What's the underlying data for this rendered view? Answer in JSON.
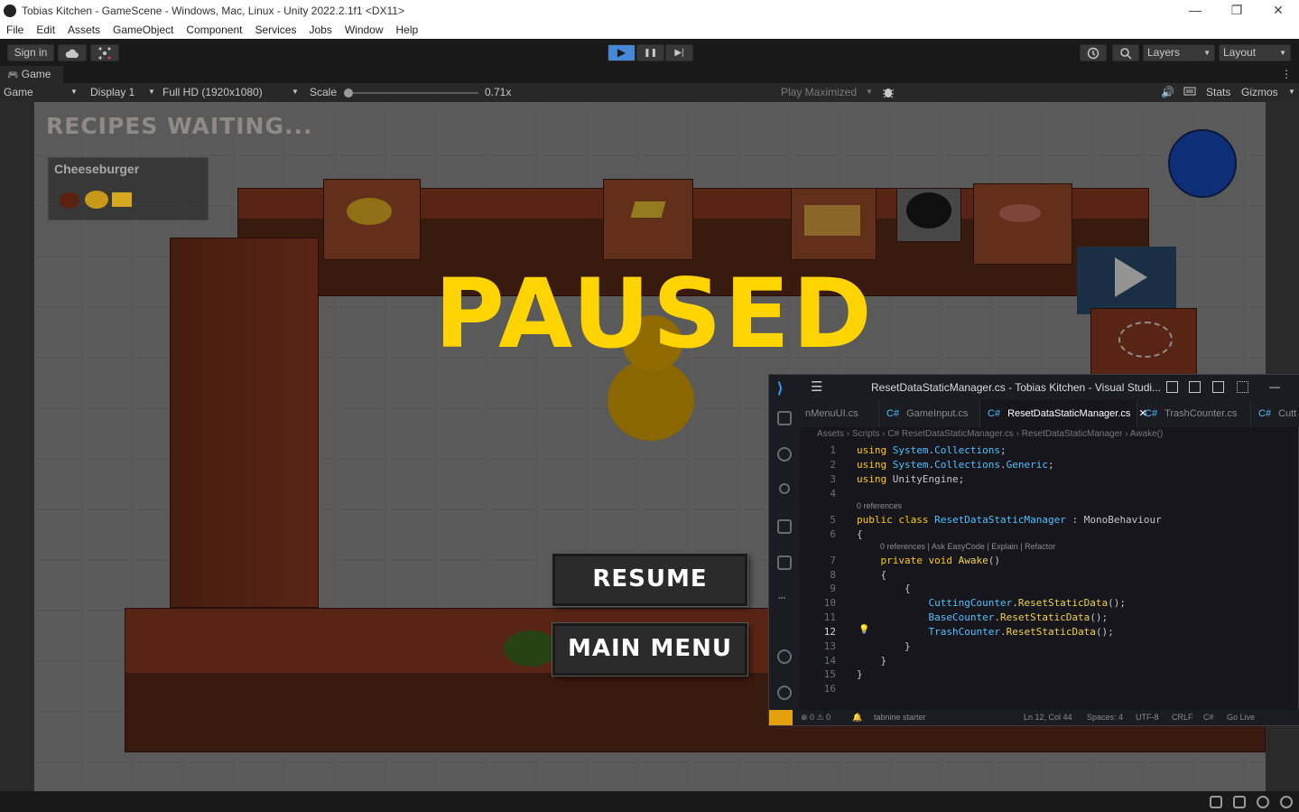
{
  "window": {
    "title": "Tobias Kitchen - GameScene - Windows, Mac, Linux - Unity 2022.2.1f1 <DX11>",
    "controls": [
      "—",
      "❐",
      "✕"
    ]
  },
  "menu": [
    "File",
    "Edit",
    "Assets",
    "GameObject",
    "Component",
    "Services",
    "Jobs",
    "Window",
    "Help"
  ],
  "toolbar": {
    "sign_in": "Sign in",
    "layers": "Layers",
    "layout": "Layout",
    "play_glyph": "▶",
    "pause_glyph": "❚❚",
    "step_glyph": "▶|"
  },
  "game_tab": {
    "label": "Game"
  },
  "game_bar": {
    "mode": "Game",
    "display": "Display 1",
    "resolution": "Full HD (1920x1080)",
    "scale_label": "Scale",
    "scale_value": "0.71x",
    "play_maximized": "Play Maximized",
    "stats": "Stats",
    "gizmos": "Gizmos"
  },
  "game": {
    "recipes_header": "RECIPES WAITING...",
    "recipe_name": "Cheeseburger",
    "paused_text": "PAUSED",
    "resume": "RESUME",
    "main_menu": "MAIN MENU",
    "accent": "#ffd400"
  },
  "vscode": {
    "title": "ResetDataStaticManager.cs - Tobias Kitchen - Visual Studi...",
    "tabs": [
      {
        "label": "nMenuUI.cs",
        "lang": ""
      },
      {
        "label": "GameInput.cs",
        "lang": "C#"
      },
      {
        "label": "ResetDataStaticManager.cs",
        "lang": "C#",
        "close": "✕"
      },
      {
        "label": "TrashCounter.cs",
        "lang": "C#"
      },
      {
        "label": "Cutt",
        "lang": "C#"
      }
    ],
    "breadcrumbs": "Assets › Scripts › C# ResetDataStaticManager.cs › ResetDataStaticManager › Awake()",
    "codelens_class": "0 references",
    "codelens_method": "0 references | Ask EasyCode | Explain | Refactor",
    "lines": [
      {
        "n": "1",
        "code": "using System.Collections;"
      },
      {
        "n": "2",
        "code": "using System.Collections.Generic;"
      },
      {
        "n": "3",
        "code": "using UnityEngine;"
      },
      {
        "n": "4",
        "code": ""
      },
      {
        "n": "5",
        "code": "public class ResetDataStaticManager : MonoBehaviour"
      },
      {
        "n": "6",
        "code": "{"
      },
      {
        "n": "7",
        "code": "    private void Awake()"
      },
      {
        "n": "8",
        "code": "    {"
      },
      {
        "n": "9",
        "code": "        {"
      },
      {
        "n": "10",
        "code": "            CuttingCounter.ResetStaticData();"
      },
      {
        "n": "11",
        "code": "            BaseCounter.ResetStaticData();"
      },
      {
        "n": "12",
        "code": "            TrashCounter.ResetStaticData();"
      },
      {
        "n": "13",
        "code": "        }"
      },
      {
        "n": "14",
        "code": "    }"
      },
      {
        "n": "15",
        "code": "}"
      },
      {
        "n": "16",
        "code": ""
      }
    ],
    "status": {
      "problems": "⊗ 0 ⚠ 0",
      "tabnine": "tabnine starter",
      "position": "Ln 12, Col 44",
      "spaces": "Spaces: 4",
      "encoding": "UTF-8",
      "eol": "CRLF",
      "lang": "C#",
      "golive": "Go Live"
    }
  }
}
